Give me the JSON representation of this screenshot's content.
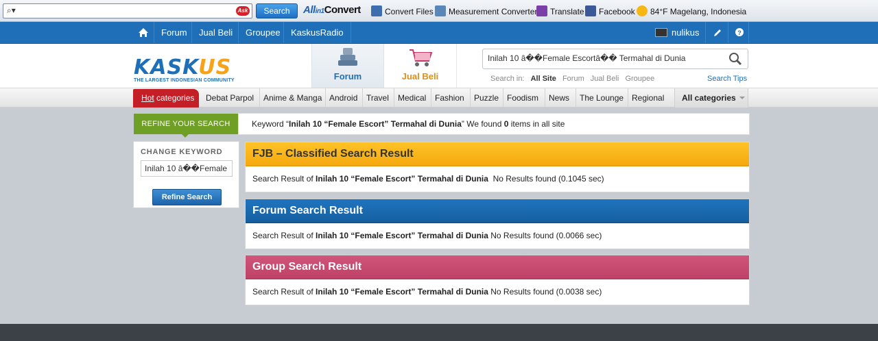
{
  "toolbar": {
    "search_button": "Search",
    "ask_badge": "Ask",
    "allinone_prefix": "All",
    "allinone_mid": "in1",
    "allinone_suffix": "Convert",
    "items": [
      {
        "label": "Convert Files",
        "icon": "convert-files-icon",
        "color": "#3d6fb0"
      },
      {
        "label": "Measurement Converter",
        "icon": "measurement-icon",
        "color": "#5b86b8"
      },
      {
        "label": "Translate",
        "icon": "translate-icon",
        "color": "#7b3fa8"
      },
      {
        "label": "Facebook",
        "icon": "facebook-icon",
        "color": "#3b5998"
      },
      {
        "label": "84°F Magelang, Indonesia",
        "icon": "weather-icon",
        "color": "#f6b614"
      }
    ]
  },
  "nav": {
    "items": [
      "Forum",
      "Jual Beli",
      "Groupee",
      "KaskusRadio"
    ],
    "username": "nulikus"
  },
  "header": {
    "logo_word_a": "KASK",
    "logo_word_b": "US",
    "logo_tagline": "THE LARGEST INDONESIAN COMMUNITY",
    "tab_forum": "Forum",
    "tab_jualbeli": "Jual Beli",
    "search_value": "Inilah 10 â��Female Escortâ�� Termahal di Dunia",
    "search_in_label": "Search in:",
    "search_in_options": [
      "All Site",
      "Forum",
      "Jual Beli",
      "Groupee"
    ],
    "search_tips": "Search Tips"
  },
  "categories": {
    "hot_a": "Hot",
    "hot_b": " categories",
    "items": [
      "Debat Parpol",
      "Anime & Manga",
      "Android",
      "Travel",
      "Medical",
      "Fashion",
      "Puzzle",
      "Foodism",
      "News",
      "The Lounge",
      "Regional"
    ],
    "all": "All categories"
  },
  "refine": {
    "badge": "REFINE YOUR SEARCH",
    "change_keyword": "CHANGE KEYWORD",
    "input_value": "Inilah 10 â��Female",
    "button": "Refine Search"
  },
  "keyword_summary": {
    "prefix": "Keyword “",
    "keyword": "Inilah 10 “Female Escort” Termahal di Dunia",
    "middle": "” We found ",
    "count": "0",
    "suffix": " items in all site"
  },
  "results": [
    {
      "title": "FJB – Classified Search Result",
      "prefix": "Search Result of ",
      "keyword": "Inilah 10 “Female Escort” Termahal di Dunia",
      "status": "  No Results found (0.1045 sec)"
    },
    {
      "title": "Forum Search Result",
      "prefix": "Search Result of ",
      "keyword": "Inilah 10 “Female Escort” Termahal di Dunia",
      "status": " No Results found (0.0066 sec)"
    },
    {
      "title": "Group Search Result",
      "prefix": "Search Result of ",
      "keyword": "Inilah 10 “Female Escort” Termahal di Dunia",
      "status": " No Results found (0.0038 sec)"
    }
  ],
  "colors": {
    "brand_blue": "#1f6fb8",
    "hot_red": "#c41f26",
    "refine_green": "#6fa025",
    "fjb_yellow": "#fec328",
    "group_pink": "#d0557b"
  }
}
